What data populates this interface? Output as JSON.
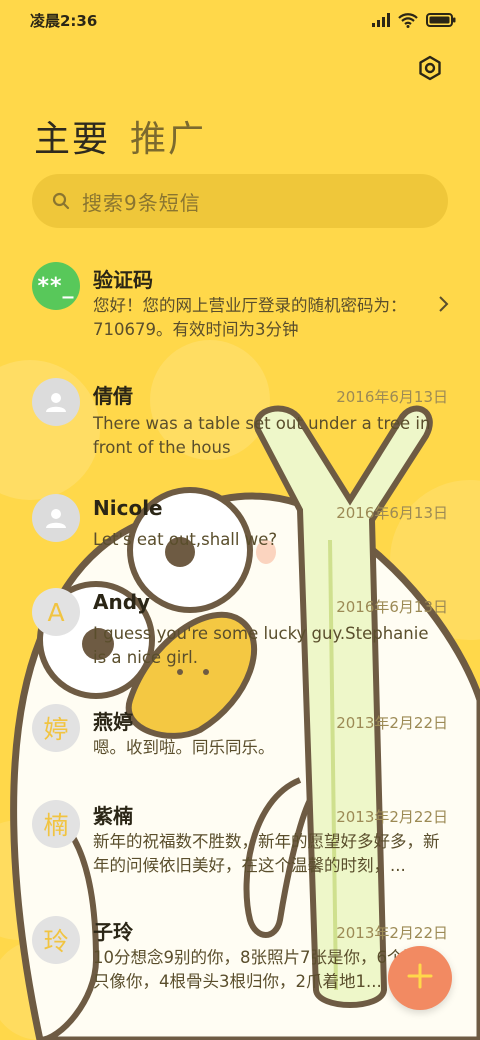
{
  "status_bar": {
    "time": "凌晨2:36"
  },
  "tabs": [
    {
      "label": "主要",
      "active": true
    },
    {
      "label": "推广",
      "active": false
    }
  ],
  "search": {
    "placeholder": "搜索9条短信"
  },
  "messages": [
    {
      "avatar": "**_",
      "avatar_type": "green",
      "name": "验证码",
      "date": "",
      "preview": "您好！您的网上营业厅登录的随机密码为：710679。有效时间为3分钟"
    },
    {
      "avatar": "",
      "avatar_type": "person",
      "name": "倩倩",
      "date": "2016年6月13日",
      "preview": "There was a table set out under a tree in front of the hous"
    },
    {
      "avatar": "",
      "avatar_type": "person",
      "name": "Nicole",
      "date": "2016年6月13日",
      "preview": "Let's eat out,shall we?"
    },
    {
      "avatar": "A",
      "avatar_type": "letter",
      "name": "Andy",
      "date": "2016年6月13日",
      "preview": "I guess you're some lucky guy.Stephanie is a nice girl."
    },
    {
      "avatar": "婷",
      "avatar_type": "letter",
      "name": "燕婷",
      "date": "2013年2月22日",
      "preview": "嗯。收到啦。同乐同乐。"
    },
    {
      "avatar": "楠",
      "avatar_type": "letter",
      "name": "紫楠",
      "date": "2013年2月22日",
      "preview": "新年的祝福数不胜数，新年的愿望好多好多，新年的问候依旧美好，在这个温馨的时刻，..."
    },
    {
      "avatar": "玲",
      "avatar_type": "letter",
      "name": "子玲",
      "date": "2013年2月22日",
      "preview": "10分想念9别的你，8张照片7张是你，6个狗5只像你，4根骨头3根归你，2爪着地1..."
    }
  ],
  "colors": {
    "background": "#ffd84a",
    "fab": "#f28a62",
    "avatar_green": "#58c85a"
  },
  "icons": [
    "signal-icon",
    "wifi-icon",
    "battery-icon",
    "settings-icon",
    "search-icon",
    "chevron-right-icon",
    "plus-icon"
  ]
}
